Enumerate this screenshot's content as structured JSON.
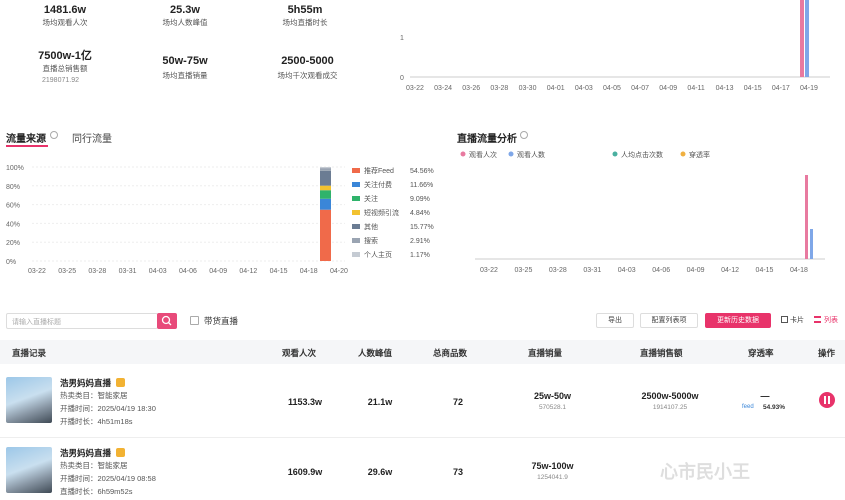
{
  "summary": {
    "row1": [
      {
        "value": "1481.6w",
        "label": "场均观看人次"
      },
      {
        "value": "25.3w",
        "label": "场均人数峰值"
      },
      {
        "value": "5h55m",
        "label": "场均直播时长"
      }
    ],
    "row2": [
      {
        "value": "7500w-1亿",
        "label": "直播总销售额",
        "sub": "2198071.92"
      },
      {
        "value": "50w-75w",
        "label": "场均直播销量"
      },
      {
        "value": "2500-5000",
        "label": "场均千次观看成交"
      }
    ]
  },
  "top_chart": {
    "y_ticks": [
      "1",
      "0"
    ],
    "x_ticks": [
      "03-22",
      "03-24",
      "03-26",
      "03-28",
      "03-30",
      "04-01",
      "04-03",
      "04-05",
      "04-07",
      "04-09",
      "04-11",
      "04-13",
      "04-15",
      "04-17",
      "04-19"
    ]
  },
  "traffic": {
    "tab_active": "流量来源",
    "tab_other": "同行流量",
    "y_ticks": [
      "100%",
      "80%",
      "60%",
      "40%",
      "20%",
      "0%"
    ],
    "x_ticks": [
      "03-22",
      "03-25",
      "03-28",
      "03-31",
      "04-03",
      "04-06",
      "04-09",
      "04-12",
      "04-15",
      "04-18",
      "04-20"
    ],
    "legend": [
      {
        "label": "推荐Feed",
        "value": "54.56%",
        "color": "#f06a4a"
      },
      {
        "label": "关注付费",
        "value": "11.66%",
        "color": "#3a86d8"
      },
      {
        "label": "关注",
        "value": "9.09%",
        "color": "#2fb36b"
      },
      {
        "label": "短视频引流",
        "value": "4.84%",
        "color": "#f2c230"
      },
      {
        "label": "其他",
        "value": "15.77%",
        "color": "#6b7c93"
      },
      {
        "label": "搜索",
        "value": "2.91%",
        "color": "#9aa4b2"
      },
      {
        "label": "个人主页",
        "value": "1.17%",
        "color": "#c5cbd3"
      }
    ]
  },
  "live_analysis": {
    "title": "直播流量分析",
    "legend": [
      {
        "label": "观看人次",
        "color": "#e87aa0"
      },
      {
        "label": "观看人数",
        "color": "#7fa7e8"
      },
      {
        "label": "人均点击次数",
        "color": "#4ab0a0"
      },
      {
        "label": "穿透率",
        "color": "#f0b040"
      }
    ],
    "x_ticks": [
      "03-22",
      "03-25",
      "03-28",
      "03-31",
      "04-03",
      "04-06",
      "04-09",
      "04-12",
      "04-15",
      "04-18"
    ]
  },
  "toolbar": {
    "search_placeholder": "请输入直播标题",
    "filter_label": "带货直播",
    "export_label": "导出",
    "config_label": "配置列表项",
    "refresh_label": "更新历史数据",
    "card_label": "卡片",
    "list_label": "列表"
  },
  "table": {
    "headers": [
      "直播记录",
      "观看人次",
      "人数峰值",
      "总商品数",
      "直播销量",
      "直播销售额",
      "穿透率",
      "操作"
    ],
    "rows": [
      {
        "name": "浩男妈妈直播",
        "category": "热卖类目：智能家居",
        "start": "开播时间：2025/04/19 18:30",
        "duration": "开播时长：4h51m18s",
        "views": "1153.3w",
        "peak": "21.1w",
        "products": "72",
        "sales": "25w-50w",
        "sales_sub": "570528.1",
        "revenue": "2500w-5000w",
        "revenue_sub": "1914107.25",
        "rate": "—",
        "rate_tag": "feed",
        "rate_val": "54.93%"
      },
      {
        "name": "浩男妈妈直播",
        "category": "热卖类目：智能家居",
        "start": "开播时间：2025/04/19 08:58",
        "duration": "直播时长：6h59m52s",
        "views": "1609.9w",
        "peak": "29.6w",
        "products": "73",
        "sales": "75w-100w",
        "sales_sub": "1254041.9",
        "revenue": "",
        "revenue_sub": "",
        "rate": "",
        "rate_tag": "",
        "rate_val": ""
      }
    ]
  },
  "watermark": "心市民小王"
}
